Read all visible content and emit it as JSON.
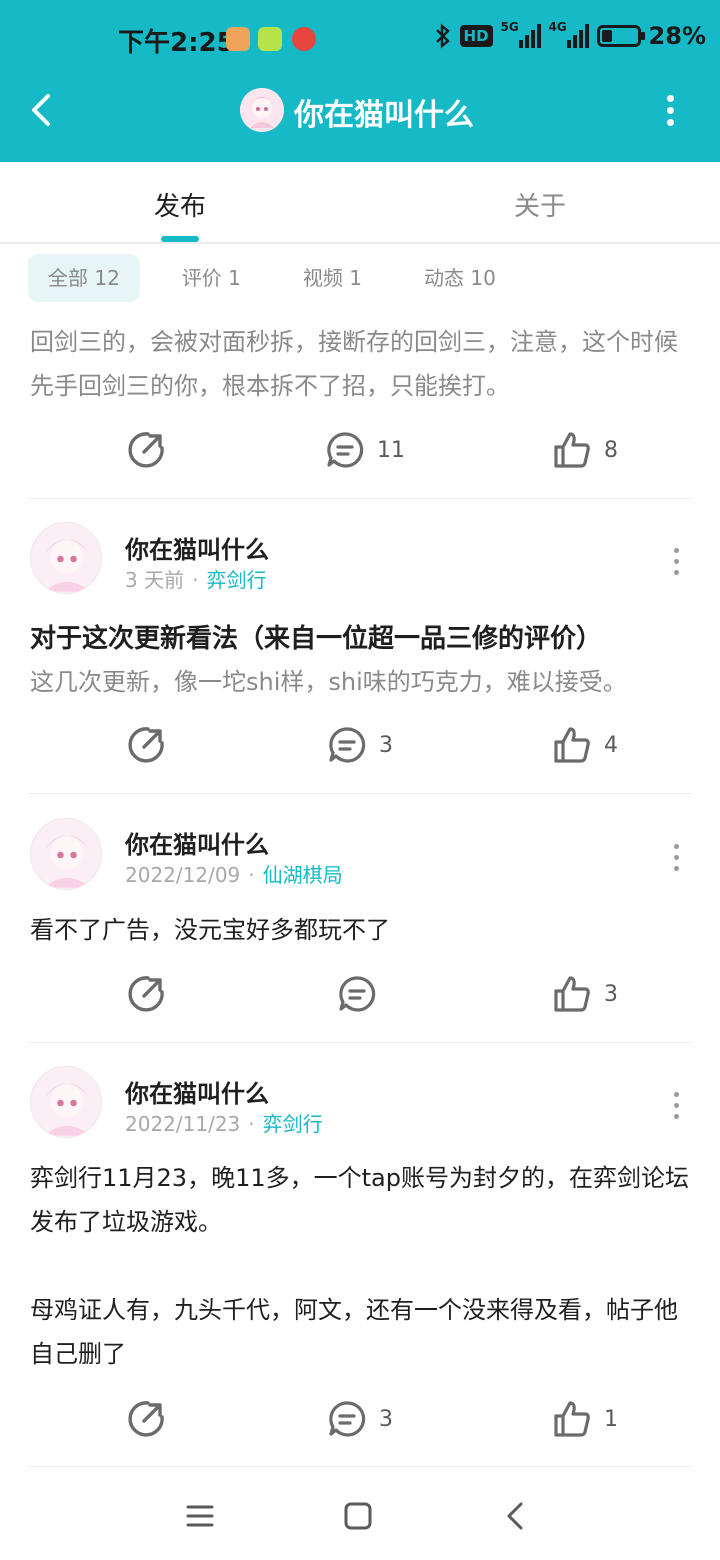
{
  "status_bar": {
    "time": "下午2:25",
    "network_5g": "5G",
    "network_4g": "4G",
    "hd_label": "HD",
    "battery": "28%"
  },
  "header": {
    "title": "你在猫叫什么",
    "background": "#16b9c6"
  },
  "tabs": [
    {
      "label": "发布",
      "active": true
    },
    {
      "label": "关于",
      "active": false
    }
  ],
  "filters": [
    {
      "label": "全部 12",
      "active": true
    },
    {
      "label": "评价 1",
      "active": false
    },
    {
      "label": "视频 1",
      "active": false
    },
    {
      "label": "动态 10",
      "active": false
    }
  ],
  "posts": [
    {
      "body": "回剑三的，会被对面秒拆，接断存的回剑三，注意，这个时候先手回剑三的你，根本拆不了招，只能挨打。",
      "comments": "11",
      "likes": "8"
    },
    {
      "author": "你在猫叫什么",
      "time": "3 天前",
      "game": "弈剑行",
      "title": "对于这次更新看法（来自一位超一品三修的评价）",
      "body": "这几次更新，像一坨shi样，shi味的巧克力，难以接受。",
      "comments": "3",
      "likes": "4"
    },
    {
      "author": "你在猫叫什么",
      "time": "2022/12/09",
      "game": "仙湖棋局",
      "body": "看不了广告，没元宝好多都玩不了",
      "comments": "",
      "likes": "3"
    },
    {
      "author": "你在猫叫什么",
      "time": "2022/11/23",
      "game": "弈剑行",
      "body_p1": "弈剑行11月23，晚11多，一个tap账号为封夕的，在弈剑论坛发布了垃圾游戏。",
      "body_p2": "母鸡证人有，九头千代，阿文，还有一个没来得及看，帖子他自己删了",
      "comments": "3",
      "likes": "1"
    }
  ],
  "meta_separator": "·",
  "colors": {
    "accent": "#16b9c6",
    "text": "#1f1f1f",
    "muted": "#8a8a8a",
    "icon": "#5a5a5a"
  },
  "icons": [
    "back-arrow-icon",
    "more-vertical-icon",
    "share-icon",
    "comment-icon",
    "like-icon",
    "menu-icon",
    "home-square-icon",
    "back-chevron-icon"
  ]
}
